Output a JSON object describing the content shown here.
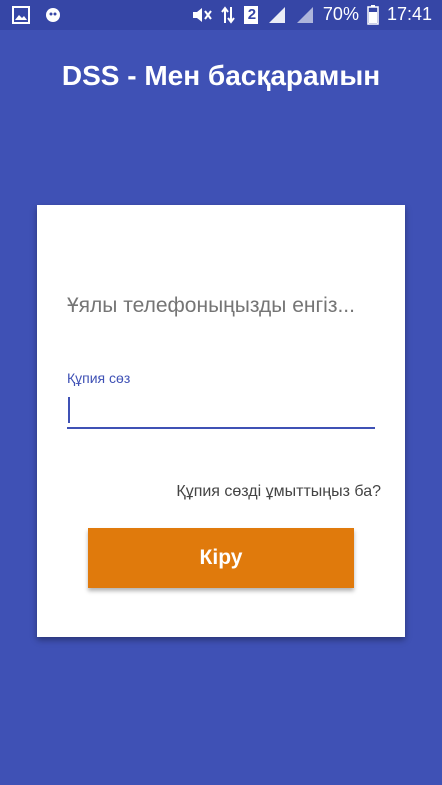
{
  "status_bar": {
    "battery_percent": "70%",
    "time": "17:41",
    "sim_slot": "2",
    "icons": [
      "gallery-icon",
      "notification-icon",
      "mute-icon",
      "data-arrows-icon",
      "sim-icon",
      "signal-icon",
      "signal-icon-2",
      "battery-icon"
    ]
  },
  "app": {
    "title": "DSS - Мен басқарамын"
  },
  "login": {
    "phone_placeholder": "Ұялы телефоныңызды енгіз...",
    "password_label": "Құпия сөз",
    "password_value": "",
    "forgot_link": "Құпия сөзді ұмыттыңыз ба?",
    "login_button": "Кіру"
  },
  "colors": {
    "background": "#3f51b5",
    "accent": "#3f51b5",
    "button": "#e07a0c",
    "card": "#ffffff"
  }
}
